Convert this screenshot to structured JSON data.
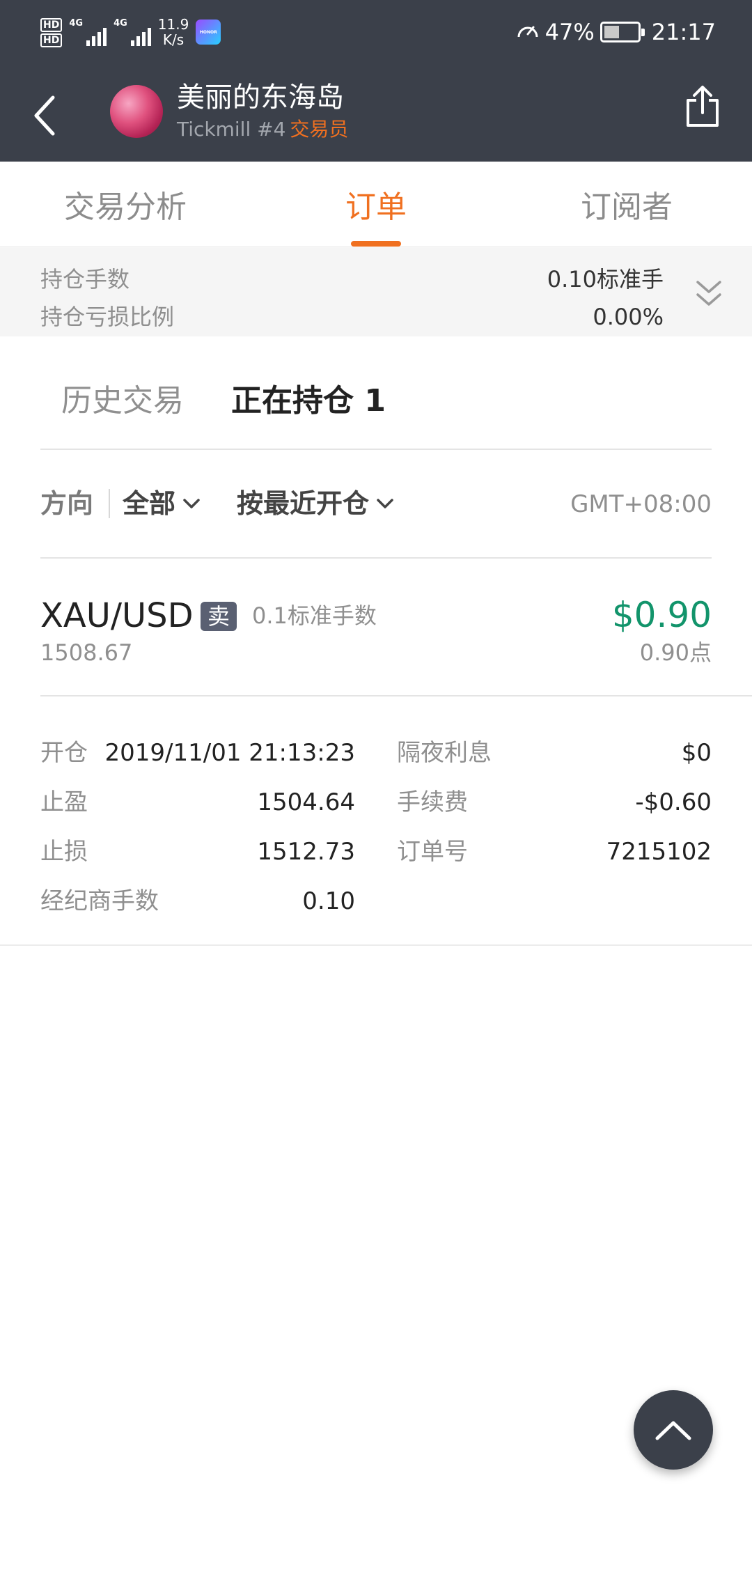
{
  "status_bar": {
    "hd1": "HD",
    "hd2": "HD",
    "net_gen1": "4G",
    "net_gen2": "4G",
    "net_speed_value": "11.9",
    "net_speed_unit": "K/s",
    "honor_label": "HONOR",
    "battery_percent": "47%",
    "battery_level": 0.47,
    "time": "21:17"
  },
  "header": {
    "title": "美丽的东海岛",
    "subtitle_broker": "Tickmill #4",
    "subtitle_role": "交易员",
    "accent_color": "#f07020"
  },
  "tabs": [
    {
      "label": "交易分析",
      "active": false
    },
    {
      "label": "订单",
      "active": true
    },
    {
      "label": "订阅者",
      "active": false
    }
  ],
  "summary": {
    "position_lots_label": "持仓手数",
    "position_lots_value": "0.10标准手",
    "pnl_ratio_label": "持仓亏损比例",
    "pnl_ratio_value": "0.00%"
  },
  "subtabs": {
    "history": "历史交易",
    "open": "正在持仓 1"
  },
  "filters": {
    "direction_label": "方向",
    "direction_value": "全部",
    "sort_value": "按最近开仓",
    "timezone": "GMT+08:00"
  },
  "position": {
    "symbol": "XAU/USD",
    "side": "卖",
    "lots": "0.1标准手数",
    "price": "1508.67",
    "profit": "$0.90",
    "profit_points": "0.90点",
    "profit_color": "#12946b"
  },
  "details": {
    "open_label": "开仓",
    "open_value": "2019/11/01 21:13:23",
    "tp_label": "止盈",
    "tp_value": "1504.64",
    "sl_label": "止损",
    "sl_value": "1512.73",
    "broker_lots_label": "经纪商手数",
    "broker_lots_value": "0.10",
    "swap_label": "隔夜利息",
    "swap_value": "$0",
    "fee_label": "手续费",
    "fee_value": "-$0.60",
    "order_no_label": "订单号",
    "order_no_value": "7215102"
  },
  "icons": {
    "back": "chevron-left-icon",
    "share": "share-icon",
    "expand": "double-chevron-down-icon",
    "dropdown": "chevron-down-icon",
    "scroll_top": "chevron-up-icon"
  }
}
